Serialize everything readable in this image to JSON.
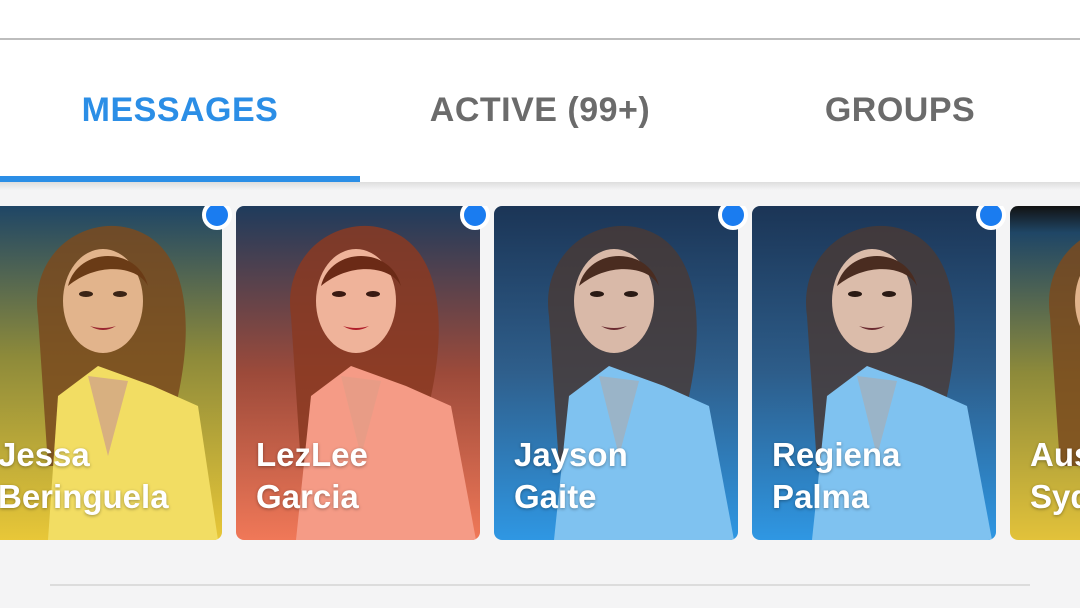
{
  "tabs": [
    {
      "label": "MESSAGES",
      "active": true
    },
    {
      "label": "ACTIVE (99+)",
      "active": false
    },
    {
      "label": "GROUPS",
      "active": false
    }
  ],
  "colors": {
    "accent": "#2b8ee6",
    "unread_dot": "#1a7cf0",
    "inactive_tab": "#6b6b6b"
  },
  "stories": [
    {
      "first": "Jessa",
      "last": "Beringuela",
      "unread": true,
      "tint": "yellow"
    },
    {
      "first": "LezLee",
      "last": "Garcia",
      "unread": true,
      "tint": "coral"
    },
    {
      "first": "Jayson",
      "last": "Gaite",
      "unread": true,
      "tint": "blue"
    },
    {
      "first": "Regiena",
      "last": "Palma",
      "unread": true,
      "tint": "blue"
    },
    {
      "first": "Aus",
      "last": "Syd",
      "unread": false,
      "tint": "yellow"
    }
  ]
}
